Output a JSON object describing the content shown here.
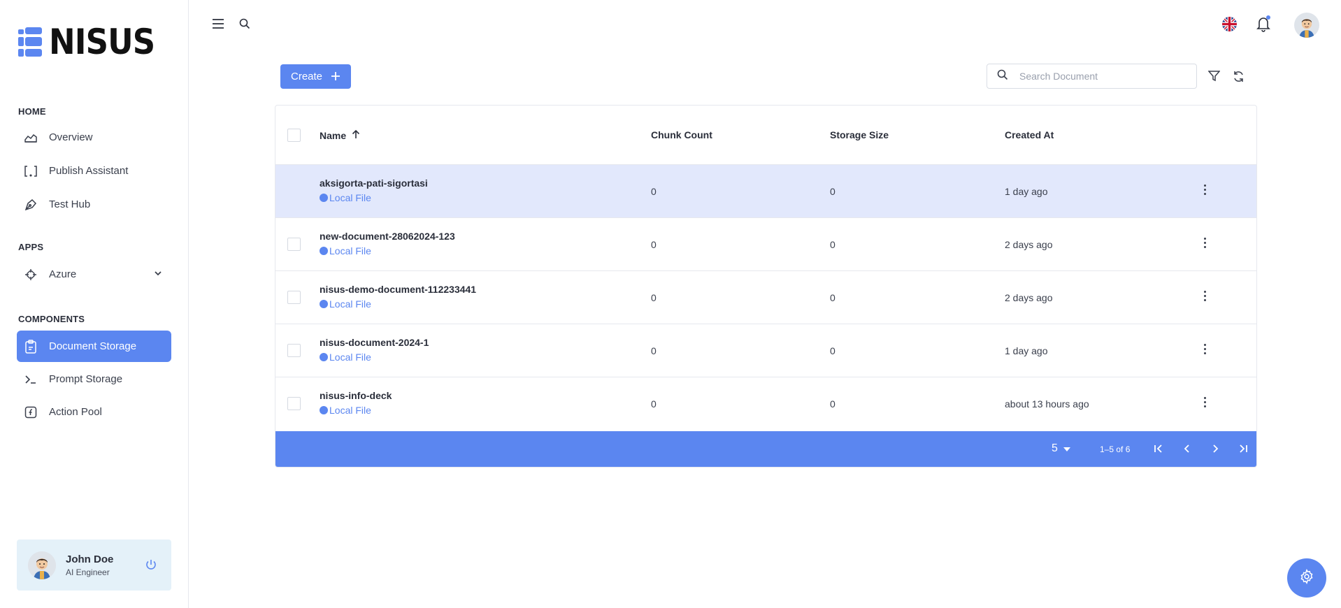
{
  "brand": {
    "name": "NISUS"
  },
  "sidebar": {
    "sections": [
      {
        "label": "HOME"
      },
      {
        "label": "APPS"
      },
      {
        "label": "COMPONENTS"
      }
    ],
    "items": [
      {
        "label": "Overview",
        "icon": "chart-area-icon"
      },
      {
        "label": "Publish Assistant",
        "icon": "brackets-icon"
      },
      {
        "label": "Test Hub",
        "icon": "pen-tool-icon"
      },
      {
        "label": "Azure",
        "icon": "azure-icon"
      },
      {
        "label": "Document Storage",
        "icon": "clipboard-icon",
        "active": true
      },
      {
        "label": "Prompt Storage",
        "icon": "terminal-icon"
      },
      {
        "label": "Action Pool",
        "icon": "function-icon"
      }
    ],
    "user": {
      "name": "John Doe",
      "role": "AI Engineer"
    }
  },
  "toolbar": {
    "create_label": "Create",
    "search_placeholder": "Search Document"
  },
  "table": {
    "columns": [
      "Name",
      "Chunk Count",
      "Storage Size",
      "Created At"
    ],
    "rows": [
      {
        "name": "aksigorta-pati-sigortasi",
        "source": "Local File",
        "chunk_count": "0",
        "storage_size": "0",
        "created_at": "1 day ago"
      },
      {
        "name": "new-document-28062024-123",
        "source": "Local File",
        "chunk_count": "0",
        "storage_size": "0",
        "created_at": "2 days ago"
      },
      {
        "name": "nisus-demo-document-112233441",
        "source": "Local File",
        "chunk_count": "0",
        "storage_size": "0",
        "created_at": "2 days ago"
      },
      {
        "name": "nisus-document-2024-1",
        "source": "Local File",
        "chunk_count": "0",
        "storage_size": "0",
        "created_at": "1 day ago"
      },
      {
        "name": "nisus-info-deck",
        "source": "Local File",
        "chunk_count": "0",
        "storage_size": "0",
        "created_at": "about 13 hours ago"
      }
    ],
    "pagination": {
      "rows_per_page": "5",
      "range": "1–5 of 6"
    }
  },
  "colors": {
    "accent": "#5b86f0",
    "highlight_row": "#e2e8fc",
    "user_card": "#e4f1f9"
  }
}
